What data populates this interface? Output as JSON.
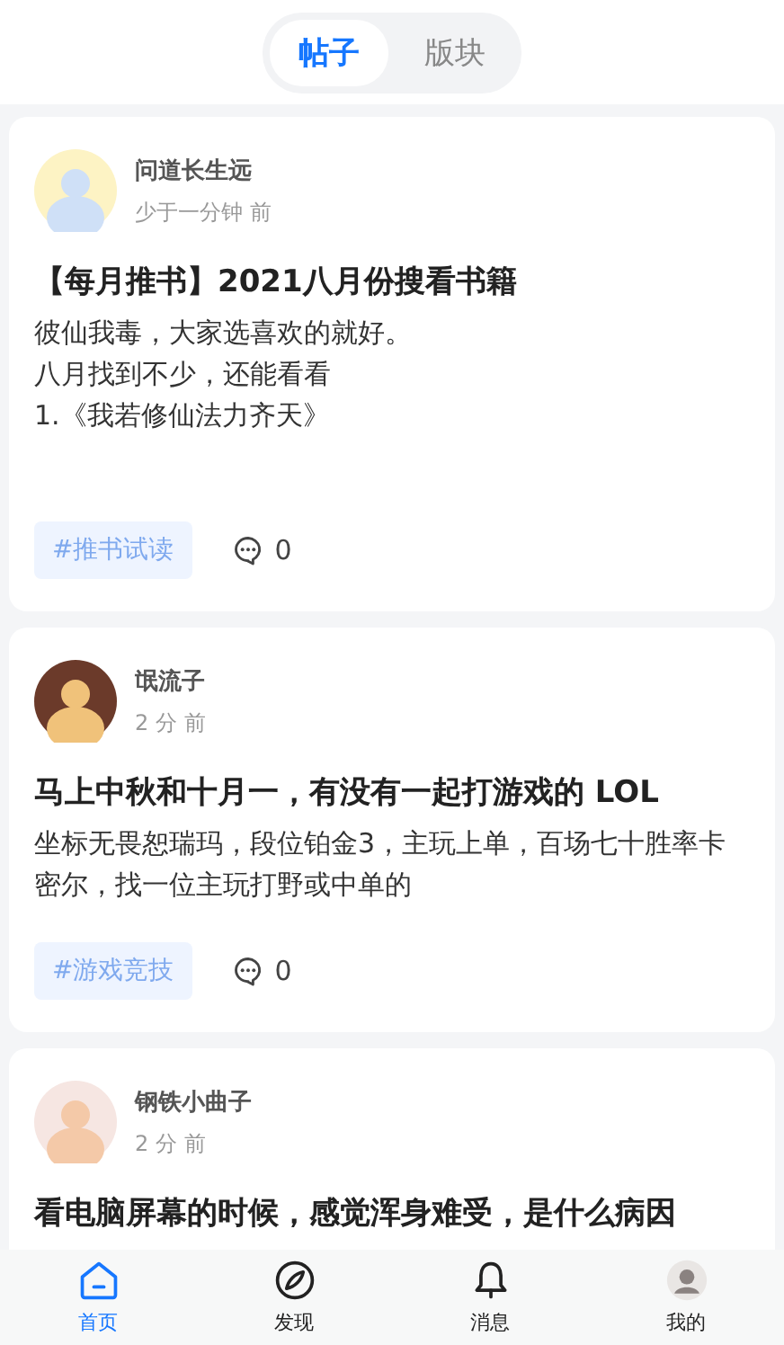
{
  "tabs": [
    {
      "label": "帖子",
      "selected": true
    },
    {
      "label": "版块",
      "selected": false
    }
  ],
  "posts": [
    {
      "author": "问道长生远",
      "time": "少于一分钟 前",
      "title": "【每月推书】2021八月份搜看书籍",
      "body": [
        "彼仙我毒，大家选喜欢的就好。",
        "八月找到不少，还能看看",
        "1.《我若修仙法力齐天》"
      ],
      "tag": "#推书试读",
      "comments": "0"
    },
    {
      "author": "氓流子",
      "time": "2 分 前",
      "title": "马上中秋和十月一，有没有一起打游戏的  LOL",
      "body": [
        "坐标无畏恕瑞玛，段位铂金3，主玩上单，百场七十胜率卡密尔，找一位主玩打野或中单的"
      ],
      "tag": "#游戏竞技",
      "comments": "0"
    },
    {
      "author": "钢铁小曲子",
      "time": "2 分 前",
      "title": "看电脑屏幕的时候，感觉浑身难受，是什么病因"
    }
  ],
  "nav": [
    {
      "label": "首页",
      "kind": "home",
      "selected": true
    },
    {
      "label": "发现",
      "kind": "discover",
      "selected": false
    },
    {
      "label": "消息",
      "kind": "bell",
      "selected": false
    },
    {
      "label": "我的",
      "kind": "avatar",
      "selected": false
    }
  ]
}
